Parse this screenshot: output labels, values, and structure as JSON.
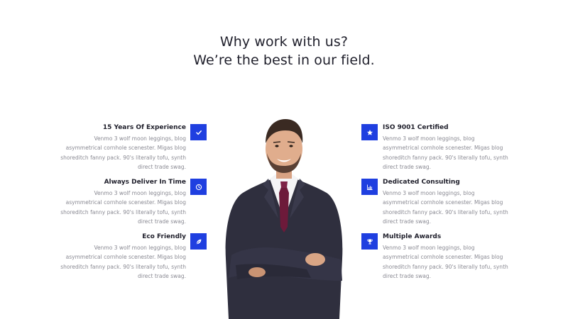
{
  "heading": {
    "line1": "Why work with us?",
    "line2": "We’re the best in our field."
  },
  "accent_color": "#1f3fe0",
  "features_left": [
    {
      "title": "15 Years Of Experience",
      "desc": [
        "Venmo 3 wolf moon leggings, blog",
        "asymmetrical cornhole scenester. Migas blog",
        "shoreditch fanny pack. 90's literally tofu, synth",
        "direct trade swag."
      ],
      "icon": "check-icon"
    },
    {
      "title": "Always Deliver In Time",
      "desc": [
        "Venmo 3 wolf moon leggings, blog",
        "asymmetrical cornhole scenester. Migas blog",
        "shoreditch fanny pack. 90's literally tofu, synth",
        "direct trade swag."
      ],
      "icon": "clock-icon"
    },
    {
      "title": "Eco Friendly",
      "desc": [
        "Venmo 3 wolf moon leggings, blog",
        "asymmetrical cornhole scenester. Migas blog",
        "shoreditch fanny pack. 90's literally tofu, synth",
        "direct trade swag."
      ],
      "icon": "leaf-icon"
    }
  ],
  "features_right": [
    {
      "title": "ISO 9001 Certified",
      "desc": [
        "Venmo 3 wolf moon leggings, blog",
        "asymmetrical cornhole scenester. Migas blog",
        "shoreditch fanny pack. 90's literally tofu, synth",
        "direct trade swag."
      ],
      "icon": "star-icon"
    },
    {
      "title": "Dedicated Consulting",
      "desc": [
        "Venmo 3 wolf moon leggings, blog",
        "asymmetrical cornhole scenester. Migas blog",
        "shoreditch fanny pack. 90's literally tofu, synth",
        "direct trade swag."
      ],
      "icon": "bar-chart-icon"
    },
    {
      "title": "Multiple Awards",
      "desc": [
        "Venmo 3 wolf moon leggings, blog",
        "asymmetrical cornhole scenester. Migas blog",
        "shoreditch fanny pack. 90's literally tofu, synth",
        "direct trade swag."
      ],
      "icon": "trophy-icon"
    }
  ]
}
